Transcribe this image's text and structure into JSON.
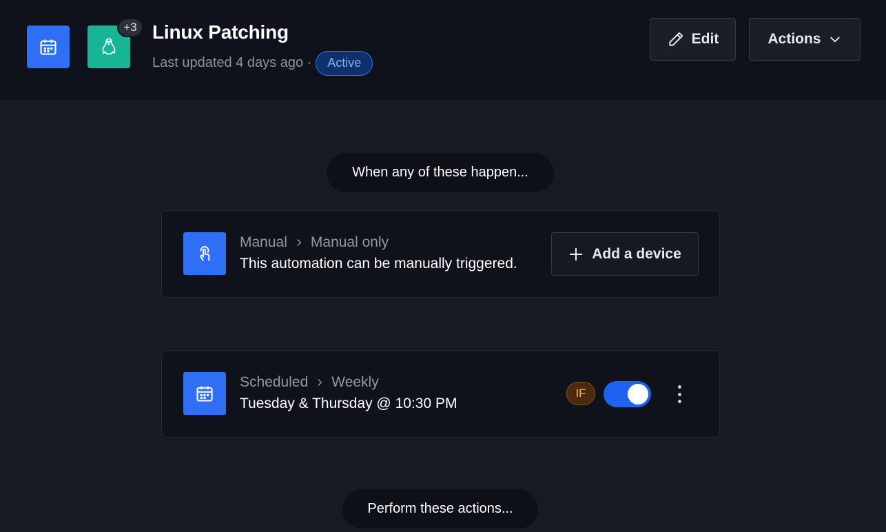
{
  "header": {
    "title": "Linux Patching",
    "last_updated": "Last updated 4 days ago ·",
    "status": "Active",
    "extra_count": "+3",
    "edit_label": "Edit",
    "actions_label": "Actions",
    "icons": [
      "calendar-icon",
      "linux-icon"
    ]
  },
  "flow": {
    "when_label": "When any of these happen...",
    "perform_label": "Perform these actions..."
  },
  "triggers": [
    {
      "icon": "hand-pointer-icon",
      "category": "Manual",
      "type": "Manual only",
      "description": "This automation can be manually triggered.",
      "action_label": "Add a device"
    },
    {
      "icon": "calendar-icon",
      "category": "Scheduled",
      "type": "Weekly",
      "description": "Tuesday & Thursday @ 10:30 PM",
      "condition_badge": "IF",
      "enabled": true
    }
  ],
  "colors": {
    "accent": "#2f6ff5",
    "linux": "#17b495",
    "background": "#161a22",
    "surface": "#0e121a"
  }
}
